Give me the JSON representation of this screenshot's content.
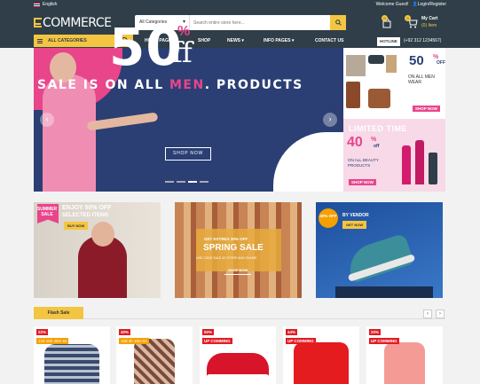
{
  "topbar": {
    "language": "English",
    "welcome": "Welcome Guest!",
    "login": "Login/Register"
  },
  "header": {
    "logo": "COMMERCE",
    "search": {
      "category": "All Categories",
      "placeholder": "Search entire store here..."
    },
    "wishlist_count": "0",
    "cart_count": "0",
    "cart_label": "My Cart",
    "cart_sub": "(0) Item"
  },
  "nav": {
    "all_categories": "ALL CATEGORIES",
    "links": [
      "HOME PAGES",
      "SHOP",
      "NEWS",
      "INFO PAGES",
      "CONTACT US"
    ],
    "hotline_label": "HOTLINE",
    "phone": "(+92 312 1234567)"
  },
  "hero": {
    "big_number": "50",
    "percent": "%",
    "off": "ff",
    "line_part1": "SALE IS ON ALL ",
    "line_men": "MEN",
    "line_part2": ". PRODUCTS",
    "button": "SHOP NOW"
  },
  "promo_men": {
    "value": "50",
    "percent": "%",
    "off": "OFF",
    "subtitle": "ON ALL MEN WEAR",
    "button": "SHOP NOW"
  },
  "promo_beauty": {
    "title": "LIMITED TIME",
    "value": "40",
    "percent": "%",
    "off": "off",
    "subtitle": "ON ALL BEAUTY PRODUCTS",
    "button": "SHOP NOW"
  },
  "banners": {
    "b1": {
      "badge_line1": "SUMMER",
      "badge_line2": "SALE",
      "title": "ENJOY 50% OFF",
      "subtitle": "SELECTED ITEMS",
      "button": "BUY NOW"
    },
    "b2": {
      "top": "GET EXTREA 30% OFF",
      "title": "SPRING SALE",
      "subtitle": "USE CODE SALE-30 STORE AND ONLINE",
      "button": "SHOP NOW"
    },
    "b3": {
      "badge": "40% OFF",
      "title": "BY VENDOR",
      "button": "GET NOW"
    }
  },
  "flash": {
    "tab": "Flash Sale",
    "prev": "‹",
    "next": "›",
    "products": [
      {
        "discount": "22%",
        "label": "12d 15h 46m 6s",
        "label_type": "timer"
      },
      {
        "discount": "40%",
        "label": "13d 4h 15m 6s",
        "label_type": "timer"
      },
      {
        "discount": "50%",
        "label": "UP COMMING",
        "label_type": "upcoming"
      },
      {
        "discount": "44%",
        "label": "UP COMMING",
        "label_type": "upcoming"
      },
      {
        "discount": "20%",
        "label": "UP COMMING",
        "label_type": "upcoming"
      }
    ]
  },
  "colors": {
    "dark": "#2f3e48",
    "accent": "#f4c542",
    "pink": "#e8458b",
    "navy": "#2b3f74",
    "red": "#e31b23"
  }
}
